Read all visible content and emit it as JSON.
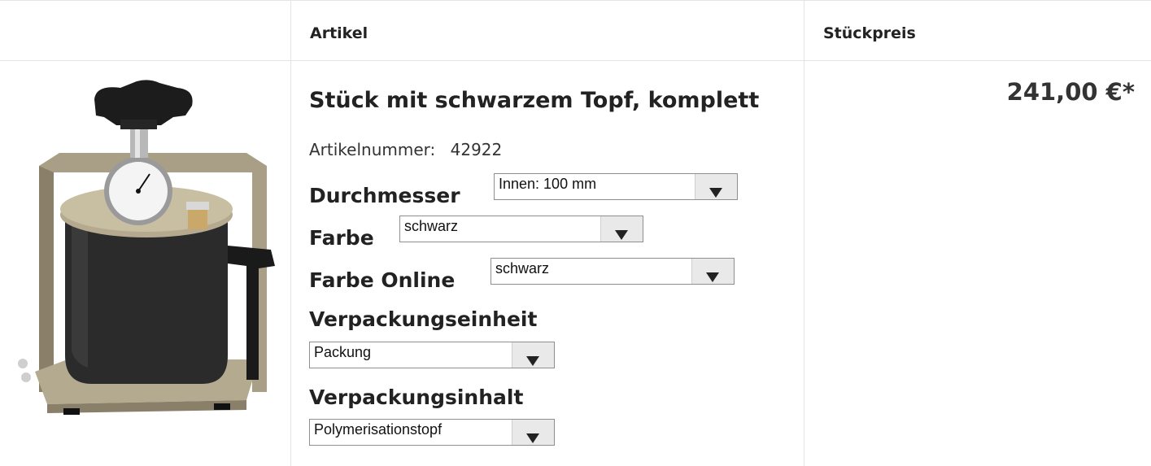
{
  "table": {
    "headers": {
      "image": "",
      "article": "Artikel",
      "unit_price": "Stückpreis"
    }
  },
  "product": {
    "title": "Stück mit schwarzem Topf, komplett",
    "article_number_label": "Artikelnummer:",
    "article_number": "42922",
    "image_icon": "pressure-pot-icon",
    "options": {
      "durchmesser": {
        "label": "Durchmesser",
        "value": "Innen: 100 mm"
      },
      "farbe": {
        "label": "Farbe",
        "value": "schwarz"
      },
      "farbe_online": {
        "label": "Farbe Online",
        "value": "schwarz"
      },
      "verpackungseinheit": {
        "label": "Verpackungseinheit",
        "value": "Packung"
      },
      "verpackungsinhalt": {
        "label": "Verpackungsinhalt",
        "value": "Polymerisationstopf"
      }
    },
    "price": "241,00 €*"
  },
  "colors": {
    "frame": "#a99e86",
    "pot": "#2b2b2b",
    "knob": "#1c1c1c",
    "border": "#e4e4e4",
    "select_button": "#e9e9e9"
  }
}
